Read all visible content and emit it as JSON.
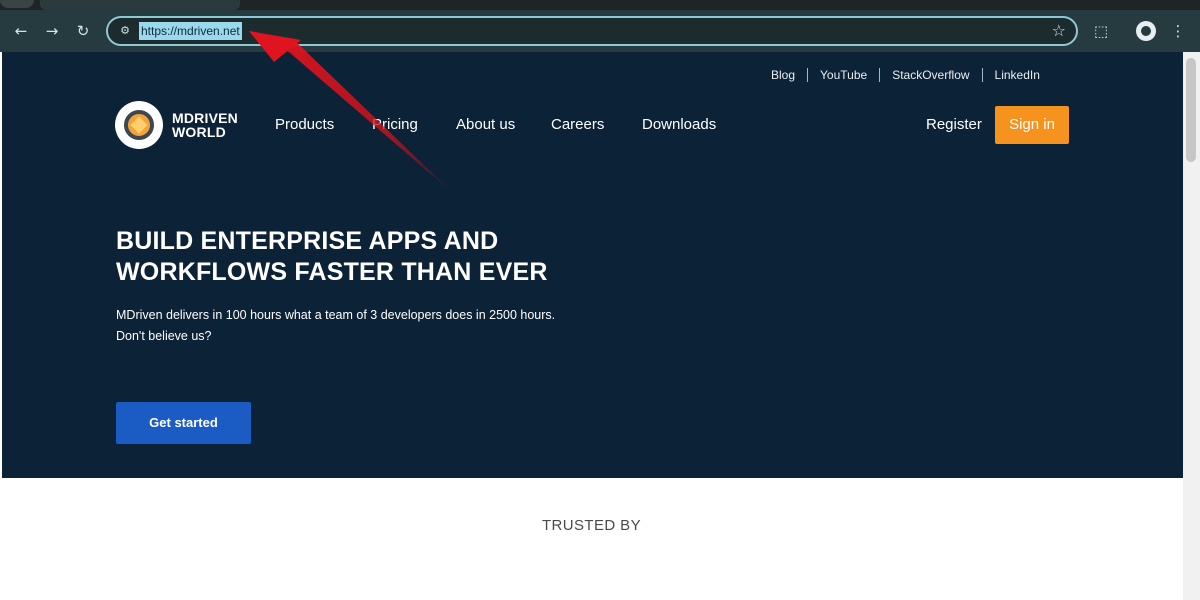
{
  "browser": {
    "url": "https://mdriven.net",
    "back_icon": "←",
    "forward_icon": "→",
    "reload_icon": "↻",
    "star_icon": "☆",
    "extensions_icon": "⬚",
    "menu_icon": "⋮",
    "site_info_icon": "⚙"
  },
  "top_links": [
    "Blog",
    "YouTube",
    "StackOverflow",
    "LinkedIn"
  ],
  "logo": {
    "line1": "MDRIVEN",
    "line2": "WORLD"
  },
  "nav": {
    "items": [
      "Products",
      "Pricing",
      "About us",
      "Careers",
      "Downloads"
    ],
    "register": "Register",
    "sign_in": "Sign in"
  },
  "hero": {
    "headline_line1": "BUILD ENTERPRISE APPS AND",
    "headline_line2": "WORKFLOWS FASTER THAN EVER",
    "sub_line1": "MDriven delivers in 100 hours what a team of 3 developers does in 2500 hours.",
    "sub_line2": "Don't believe us?",
    "cta": "Get started"
  },
  "trusted_label": "TRUSTED BY",
  "colors": {
    "hero_bg": "#0c2237",
    "sign_in_bg": "#f6921e",
    "cta_bg": "#1a5bc4",
    "annotation_arrow": "#d8121c"
  }
}
